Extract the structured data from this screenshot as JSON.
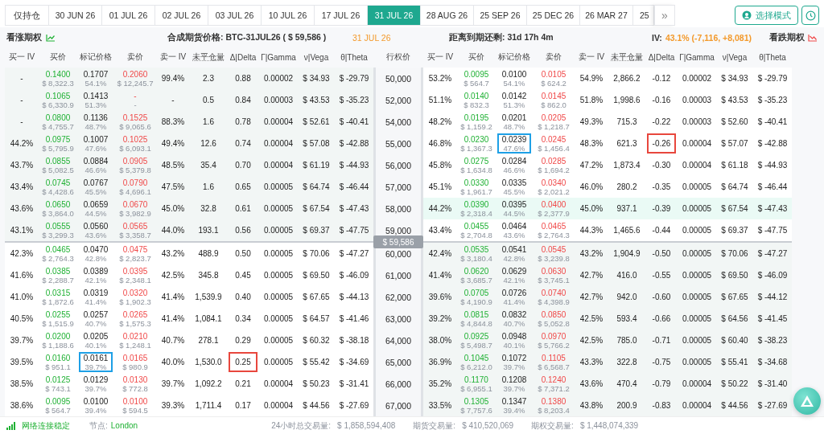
{
  "toolbar": {
    "holdings_filter": "仅持仓",
    "tabs": [
      {
        "label": "30 JUN 26",
        "selected": false
      },
      {
        "label": "01 JUL 26",
        "selected": false
      },
      {
        "label": "02 JUL 26",
        "selected": false
      },
      {
        "label": "03 JUL 26",
        "selected": false
      },
      {
        "label": "10 JUL 26",
        "selected": false
      },
      {
        "label": "17 JUL 26",
        "selected": false
      },
      {
        "label": "31 JUL 26",
        "selected": true
      },
      {
        "label": "28 AUG 26",
        "selected": false
      },
      {
        "label": "25 SEP 26",
        "selected": false
      },
      {
        "label": "25 DEC 26",
        "selected": false
      },
      {
        "label": "26 MAR 27",
        "selected": false
      },
      {
        "label": "25",
        "selected": false
      }
    ],
    "more_button": "»",
    "mode_button": "选择模式"
  },
  "info": {
    "calls_title": "看涨期权",
    "synthetic_label": "合成期货价格: BTC-31JUL26 ( $ 59,586 )",
    "expiry": "31 JUL 26",
    "countdown": "距离到期还剩: 31d 17h 4m",
    "iv_label": "IV:",
    "iv_value": "43.1% (-7,116, +8,081)",
    "puts_title": "看跌期权"
  },
  "columns": {
    "calls": [
      "买一 IV",
      "买价",
      "标记价格",
      "卖价",
      "卖一 IV",
      "未平仓量",
      "Δ|Delta",
      "Γ|Gamma",
      "ν|Vega",
      "θ|Theta"
    ],
    "strike": "行权价",
    "puts": [
      "买一 IV",
      "买价",
      "标记价格",
      "卖价",
      "卖一 IV",
      "未平仓量",
      "Δ|Delta",
      "Γ|Gamma",
      "ν|Vega",
      "θ|Theta"
    ]
  },
  "rows": [
    {
      "kind": "strike",
      "strike": "50,000",
      "call": {
        "bid_iv": "-",
        "bid": "0.1400",
        "bid_usd": "$ 8,322.3",
        "mark": "0.1707",
        "mark_iv": "54.1%",
        "ask": "0.2060",
        "ask_usd": "$ 12,245.7",
        "ask_iv": "99.4%",
        "open_interest": "2.3",
        "delta": "0.88",
        "gamma": "0.00002",
        "vega": "$ 34.93",
        "theta": "$ -29.79",
        "itm": true,
        "highlighted": false,
        "boxed_mark": false,
        "boxed_delta": false
      },
      "put": {
        "bid_iv": "53.2%",
        "bid": "0.0095",
        "bid_usd": "$ 564.7",
        "mark": "0.0100",
        "mark_iv": "54.1%",
        "ask": "0.0105",
        "ask_usd": "$ 624.2",
        "ask_iv": "54.9%",
        "open_interest": "2,866.2",
        "delta": "-0.12",
        "gamma": "0.00002",
        "vega": "$ 34.93",
        "theta": "$ -29.79",
        "itm": false,
        "highlighted": false,
        "boxed_mark": false,
        "boxed_delta": false
      }
    },
    {
      "kind": "strike",
      "strike": "52,000",
      "call": {
        "bid_iv": "-",
        "bid": "0.1065",
        "bid_usd": "$ 6,330.9",
        "mark": "0.1413",
        "mark_iv": "51.3%",
        "ask": "-",
        "ask_usd": "-",
        "ask_iv": "-",
        "open_interest": "0.5",
        "delta": "0.84",
        "gamma": "0.00003",
        "vega": "$ 43.53",
        "theta": "$ -35.23",
        "itm": true,
        "highlighted": false,
        "boxed_mark": false,
        "boxed_delta": false
      },
      "put": {
        "bid_iv": "51.1%",
        "bid": "0.0140",
        "bid_usd": "$ 832.3",
        "mark": "0.0142",
        "mark_iv": "51.3%",
        "ask": "0.0145",
        "ask_usd": "$ 862.0",
        "ask_iv": "51.8%",
        "open_interest": "1,998.6",
        "delta": "-0.16",
        "gamma": "0.00003",
        "vega": "$ 43.53",
        "theta": "$ -35.23",
        "itm": false,
        "highlighted": false,
        "boxed_mark": false,
        "boxed_delta": false
      }
    },
    {
      "kind": "strike",
      "strike": "54,000",
      "call": {
        "bid_iv": "-",
        "bid": "0.0800",
        "bid_usd": "$ 4,755.7",
        "mark": "0.1136",
        "mark_iv": "48.7%",
        "ask": "0.1525",
        "ask_usd": "$ 9,065.6",
        "ask_iv": "88.3%",
        "open_interest": "1.6",
        "delta": "0.78",
        "gamma": "0.00004",
        "vega": "$ 52.61",
        "theta": "$ -40.41",
        "itm": true,
        "highlighted": false,
        "boxed_mark": false,
        "boxed_delta": false
      },
      "put": {
        "bid_iv": "48.2%",
        "bid": "0.0195",
        "bid_usd": "$ 1,159.2",
        "mark": "0.0201",
        "mark_iv": "48.7%",
        "ask": "0.0205",
        "ask_usd": "$ 1,218.7",
        "ask_iv": "49.3%",
        "open_interest": "715.3",
        "delta": "-0.22",
        "gamma": "0.00003",
        "vega": "$ 52.60",
        "theta": "$ -40.41",
        "itm": false,
        "highlighted": false,
        "boxed_mark": false,
        "boxed_delta": false
      }
    },
    {
      "kind": "strike",
      "strike": "55,000",
      "call": {
        "bid_iv": "44.2%",
        "bid": "0.0975",
        "bid_usd": "$ 5,795.9",
        "mark": "0.1007",
        "mark_iv": "47.6%",
        "ask": "0.1025",
        "ask_usd": "$ 6,093.1",
        "ask_iv": "49.4%",
        "open_interest": "12.6",
        "delta": "0.74",
        "gamma": "0.00004",
        "vega": "$ 57.08",
        "theta": "$ -42.88",
        "itm": true,
        "highlighted": false,
        "boxed_mark": false,
        "boxed_delta": false
      },
      "put": {
        "bid_iv": "46.8%",
        "bid": "0.0230",
        "bid_usd": "$ 1,367.3",
        "mark": "0.0239",
        "mark_iv": "47.6%",
        "ask": "0.0245",
        "ask_usd": "$ 1,456.4",
        "ask_iv": "48.3%",
        "open_interest": "621.3",
        "delta": "-0.26",
        "gamma": "0.00004",
        "vega": "$ 57.07",
        "theta": "$ -42.88",
        "itm": false,
        "highlighted": false,
        "boxed_mark": true,
        "boxed_delta": true
      }
    },
    {
      "kind": "strike",
      "strike": "56,000",
      "call": {
        "bid_iv": "43.7%",
        "bid": "0.0855",
        "bid_usd": "$ 5,082.5",
        "mark": "0.0884",
        "mark_iv": "46.6%",
        "ask": "0.0905",
        "ask_usd": "$ 5,379.8",
        "ask_iv": "48.5%",
        "open_interest": "35.4",
        "delta": "0.70",
        "gamma": "0.00004",
        "vega": "$ 61.19",
        "theta": "$ -44.93",
        "itm": true,
        "highlighted": false,
        "boxed_mark": false,
        "boxed_delta": false
      },
      "put": {
        "bid_iv": "45.8%",
        "bid": "0.0275",
        "bid_usd": "$ 1,634.8",
        "mark": "0.0284",
        "mark_iv": "46.6%",
        "ask": "0.0285",
        "ask_usd": "$ 1,694.2",
        "ask_iv": "47.2%",
        "open_interest": "1,873.4",
        "delta": "-0.30",
        "gamma": "0.00004",
        "vega": "$ 61.18",
        "theta": "$ -44.93",
        "itm": false,
        "highlighted": false,
        "boxed_mark": false,
        "boxed_delta": false
      }
    },
    {
      "kind": "strike",
      "strike": "57,000",
      "call": {
        "bid_iv": "43.4%",
        "bid": "0.0745",
        "bid_usd": "$ 4,428.6",
        "mark": "0.0767",
        "mark_iv": "45.5%",
        "ask": "0.0790",
        "ask_usd": "$ 4,696.1",
        "ask_iv": "47.5%",
        "open_interest": "1.6",
        "delta": "0.65",
        "gamma": "0.00005",
        "vega": "$ 64.74",
        "theta": "$ -46.44",
        "itm": true,
        "highlighted": false,
        "boxed_mark": false,
        "boxed_delta": false
      },
      "put": {
        "bid_iv": "45.1%",
        "bid": "0.0330",
        "bid_usd": "$ 1,961.7",
        "mark": "0.0335",
        "mark_iv": "45.5%",
        "ask": "0.0340",
        "ask_usd": "$ 2,021.2",
        "ask_iv": "46.0%",
        "open_interest": "280.2",
        "delta": "-0.35",
        "gamma": "0.00005",
        "vega": "$ 64.74",
        "theta": "$ -46.44",
        "itm": false,
        "highlighted": false,
        "boxed_mark": false,
        "boxed_delta": false
      }
    },
    {
      "kind": "strike",
      "strike": "58,000",
      "call": {
        "bid_iv": "43.6%",
        "bid": "0.0650",
        "bid_usd": "$ 3,864.0",
        "mark": "0.0659",
        "mark_iv": "44.5%",
        "ask": "0.0670",
        "ask_usd": "$ 3,982.9",
        "ask_iv": "45.0%",
        "open_interest": "32.8",
        "delta": "0.61",
        "gamma": "0.00005",
        "vega": "$ 67.54",
        "theta": "$ -47.43",
        "itm": true,
        "highlighted": false,
        "boxed_mark": false,
        "boxed_delta": false
      },
      "put": {
        "bid_iv": "44.2%",
        "bid": "0.0390",
        "bid_usd": "$ 2,318.4",
        "mark": "0.0395",
        "mark_iv": "44.5%",
        "ask": "0.0400",
        "ask_usd": "$ 2,377.9",
        "ask_iv": "45.0%",
        "open_interest": "937.1",
        "delta": "-0.39",
        "gamma": "0.00005",
        "vega": "$ 67.54",
        "theta": "$ -47.43",
        "itm": false,
        "highlighted": true,
        "boxed_mark": false,
        "boxed_delta": false
      }
    },
    {
      "kind": "strike",
      "strike": "59,000",
      "call": {
        "bid_iv": "43.1%",
        "bid": "0.0555",
        "bid_usd": "$ 3,299.3",
        "mark": "0.0560",
        "mark_iv": "43.6%",
        "ask": "0.0565",
        "ask_usd": "$ 3,358.7",
        "ask_iv": "44.0%",
        "open_interest": "193.1",
        "delta": "0.56",
        "gamma": "0.00005",
        "vega": "$ 69.37",
        "theta": "$ -47.75",
        "itm": true,
        "highlighted": false,
        "boxed_mark": false,
        "boxed_delta": false
      },
      "put": {
        "bid_iv": "43.4%",
        "bid": "0.0455",
        "bid_usd": "$ 2,704.8",
        "mark": "0.0464",
        "mark_iv": "43.6%",
        "ask": "0.0465",
        "ask_usd": "$ 2,764.3",
        "ask_iv": "44.3%",
        "open_interest": "1,465.6",
        "delta": "-0.44",
        "gamma": "0.00005",
        "vega": "$ 69.37",
        "theta": "$ -47.75",
        "itm": false,
        "highlighted": false,
        "boxed_mark": false,
        "boxed_delta": false
      }
    },
    {
      "kind": "spot",
      "label": "$ 59,586"
    },
    {
      "kind": "strike",
      "strike": "60,000",
      "call": {
        "bid_iv": "42.3%",
        "bid": "0.0465",
        "bid_usd": "$ 2,764.3",
        "mark": "0.0470",
        "mark_iv": "42.8%",
        "ask": "0.0475",
        "ask_usd": "$ 2,823.7",
        "ask_iv": "43.2%",
        "open_interest": "488.9",
        "delta": "0.50",
        "gamma": "0.00005",
        "vega": "$ 70.06",
        "theta": "$ -47.27",
        "itm": false,
        "highlighted": false,
        "boxed_mark": false,
        "boxed_delta": false
      },
      "put": {
        "bid_iv": "42.4%",
        "bid": "0.0535",
        "bid_usd": "$ 3,180.4",
        "mark": "0.0541",
        "mark_iv": "42.8%",
        "ask": "0.0545",
        "ask_usd": "$ 3,239.8",
        "ask_iv": "43.2%",
        "open_interest": "1,904.9",
        "delta": "-0.50",
        "gamma": "0.00005",
        "vega": "$ 70.06",
        "theta": "$ -47.27",
        "itm": true,
        "highlighted": false,
        "boxed_mark": false,
        "boxed_delta": false
      }
    },
    {
      "kind": "strike",
      "strike": "61,000",
      "call": {
        "bid_iv": "41.6%",
        "bid": "0.0385",
        "bid_usd": "$ 2,288.7",
        "mark": "0.0389",
        "mark_iv": "42.1%",
        "ask": "0.0395",
        "ask_usd": "$ 2,348.1",
        "ask_iv": "42.5%",
        "open_interest": "345.8",
        "delta": "0.45",
        "gamma": "0.00005",
        "vega": "$ 69.50",
        "theta": "$ -46.09",
        "itm": false,
        "highlighted": false,
        "boxed_mark": false,
        "boxed_delta": false
      },
      "put": {
        "bid_iv": "41.4%",
        "bid": "0.0620",
        "bid_usd": "$ 3,685.7",
        "mark": "0.0629",
        "mark_iv": "42.1%",
        "ask": "0.0630",
        "ask_usd": "$ 3,745.1",
        "ask_iv": "42.7%",
        "open_interest": "416.0",
        "delta": "-0.55",
        "gamma": "0.00005",
        "vega": "$ 69.50",
        "theta": "$ -46.09",
        "itm": true,
        "highlighted": false,
        "boxed_mark": false,
        "boxed_delta": false
      }
    },
    {
      "kind": "strike",
      "strike": "62,000",
      "call": {
        "bid_iv": "41.0%",
        "bid": "0.0315",
        "bid_usd": "$ 1,872.6",
        "mark": "0.0319",
        "mark_iv": "41.4%",
        "ask": "0.0320",
        "ask_usd": "$ 1,902.3",
        "ask_iv": "41.4%",
        "open_interest": "1,539.9",
        "delta": "0.40",
        "gamma": "0.00005",
        "vega": "$ 67.65",
        "theta": "$ -44.13",
        "itm": false,
        "highlighted": false,
        "boxed_mark": false,
        "boxed_delta": false
      },
      "put": {
        "bid_iv": "39.6%",
        "bid": "0.0705",
        "bid_usd": "$ 4,190.9",
        "mark": "0.0726",
        "mark_iv": "41.4%",
        "ask": "0.0740",
        "ask_usd": "$ 4,398.9",
        "ask_iv": "42.7%",
        "open_interest": "942.0",
        "delta": "-0.60",
        "gamma": "0.00005",
        "vega": "$ 67.65",
        "theta": "$ -44.12",
        "itm": true,
        "highlighted": false,
        "boxed_mark": false,
        "boxed_delta": false
      }
    },
    {
      "kind": "strike",
      "strike": "63,000",
      "call": {
        "bid_iv": "40.5%",
        "bid": "0.0255",
        "bid_usd": "$ 1,515.9",
        "mark": "0.0257",
        "mark_iv": "40.7%",
        "ask": "0.0265",
        "ask_usd": "$ 1,575.3",
        "ask_iv": "41.4%",
        "open_interest": "1,084.1",
        "delta": "0.34",
        "gamma": "0.00005",
        "vega": "$ 64.57",
        "theta": "$ -41.46",
        "itm": false,
        "highlighted": false,
        "boxed_mark": false,
        "boxed_delta": false
      },
      "put": {
        "bid_iv": "39.2%",
        "bid": "0.0815",
        "bid_usd": "$ 4,844.8",
        "mark": "0.0832",
        "mark_iv": "40.7%",
        "ask": "0.0850",
        "ask_usd": "$ 5,052.8",
        "ask_iv": "42.5%",
        "open_interest": "593.4",
        "delta": "-0.66",
        "gamma": "0.00005",
        "vega": "$ 64.56",
        "theta": "$ -41.45",
        "itm": true,
        "highlighted": false,
        "boxed_mark": false,
        "boxed_delta": false
      }
    },
    {
      "kind": "strike",
      "strike": "64,000",
      "call": {
        "bid_iv": "39.7%",
        "bid": "0.0200",
        "bid_usd": "$ 1,188.6",
        "mark": "0.0205",
        "mark_iv": "40.1%",
        "ask": "0.0210",
        "ask_usd": "$ 1,248.1",
        "ask_iv": "40.7%",
        "open_interest": "278.1",
        "delta": "0.29",
        "gamma": "0.00005",
        "vega": "$ 60.32",
        "theta": "$ -38.18",
        "itm": false,
        "highlighted": false,
        "boxed_mark": false,
        "boxed_delta": false
      },
      "put": {
        "bid_iv": "38.0%",
        "bid": "0.0925",
        "bid_usd": "$ 5,498.7",
        "mark": "0.0948",
        "mark_iv": "40.1%",
        "ask": "0.0970",
        "ask_usd": "$ 5,766.2",
        "ask_iv": "42.5%",
        "open_interest": "785.0",
        "delta": "-0.71",
        "gamma": "0.00005",
        "vega": "$ 60.40",
        "theta": "$ -38.23",
        "itm": true,
        "highlighted": false,
        "boxed_mark": false,
        "boxed_delta": false
      }
    },
    {
      "kind": "strike",
      "strike": "65,000",
      "call": {
        "bid_iv": "39.5%",
        "bid": "0.0160",
        "bid_usd": "$ 951.1",
        "mark": "0.0161",
        "mark_iv": "39.7%",
        "ask": "0.0165",
        "ask_usd": "$ 980.9",
        "ask_iv": "40.0%",
        "open_interest": "1,530.0",
        "delta": "0.25",
        "gamma": "0.00005",
        "vega": "$ 55.42",
        "theta": "$ -34.69",
        "itm": false,
        "highlighted": false,
        "boxed_mark": true,
        "boxed_delta": true
      },
      "put": {
        "bid_iv": "36.9%",
        "bid": "0.1045",
        "bid_usd": "$ 6,212.0",
        "mark": "0.1072",
        "mark_iv": "39.7%",
        "ask": "0.1105",
        "ask_usd": "$ 6,568.7",
        "ask_iv": "43.3%",
        "open_interest": "322.8",
        "delta": "-0.75",
        "gamma": "0.00005",
        "vega": "$ 55.41",
        "theta": "$ -34.68",
        "itm": true,
        "highlighted": false,
        "boxed_mark": false,
        "boxed_delta": false
      }
    },
    {
      "kind": "strike",
      "strike": "66,000",
      "call": {
        "bid_iv": "38.5%",
        "bid": "0.0125",
        "bid_usd": "$ 743.1",
        "mark": "0.0129",
        "mark_iv": "39.7%",
        "ask": "0.0130",
        "ask_usd": "$ 772.8",
        "ask_iv": "39.7%",
        "open_interest": "1,092.2",
        "delta": "0.21",
        "gamma": "0.00004",
        "vega": "$ 50.23",
        "theta": "$ -31.41",
        "itm": false,
        "highlighted": false,
        "boxed_mark": false,
        "boxed_delta": false
      },
      "put": {
        "bid_iv": "35.2%",
        "bid": "0.1170",
        "bid_usd": "$ 6,955.1",
        "mark": "0.1208",
        "mark_iv": "39.7%",
        "ask": "0.1240",
        "ask_usd": "$ 7,371.2",
        "ask_iv": "43.6%",
        "open_interest": "470.4",
        "delta": "-0.79",
        "gamma": "0.00004",
        "vega": "$ 50.22",
        "theta": "$ -31.40",
        "itm": true,
        "highlighted": false,
        "boxed_mark": false,
        "boxed_delta": false
      }
    },
    {
      "kind": "strike",
      "strike": "67,000",
      "call": {
        "bid_iv": "38.6%",
        "bid": "0.0095",
        "bid_usd": "$ 564.7",
        "mark": "0.0100",
        "mark_iv": "39.4%",
        "ask": "0.0100",
        "ask_usd": "$ 594.5",
        "ask_iv": "39.3%",
        "open_interest": "1,711.4",
        "delta": "0.17",
        "gamma": "0.00004",
        "vega": "$ 44.56",
        "theta": "$ -27.69",
        "itm": false,
        "highlighted": false,
        "boxed_mark": false,
        "boxed_delta": false
      },
      "put": {
        "bid_iv": "33.5%",
        "bid": "0.1305",
        "bid_usd": "$ 7,757.6",
        "mark": "0.1347",
        "mark_iv": "39.4%",
        "ask": "0.1380",
        "ask_usd": "$ 8,203.4",
        "ask_iv": "43.8%",
        "open_interest": "200.9",
        "delta": "-0.83",
        "gamma": "0.00004",
        "vega": "$ 44.56",
        "theta": "$ -27.69",
        "itm": true,
        "highlighted": false,
        "boxed_mark": false,
        "boxed_delta": false
      }
    }
  ],
  "status_bar": {
    "connection": "网络连接稳定",
    "node_label": "节点:",
    "node": "London",
    "volume_24h_label": "24小时总交易量:",
    "volume_24h": "$ 1,858,594,408",
    "futures_label": "期货交易量:",
    "futures": "$ 410,520,069",
    "options_label": "期权交易量:",
    "options": "$ 1,448,074,339"
  }
}
